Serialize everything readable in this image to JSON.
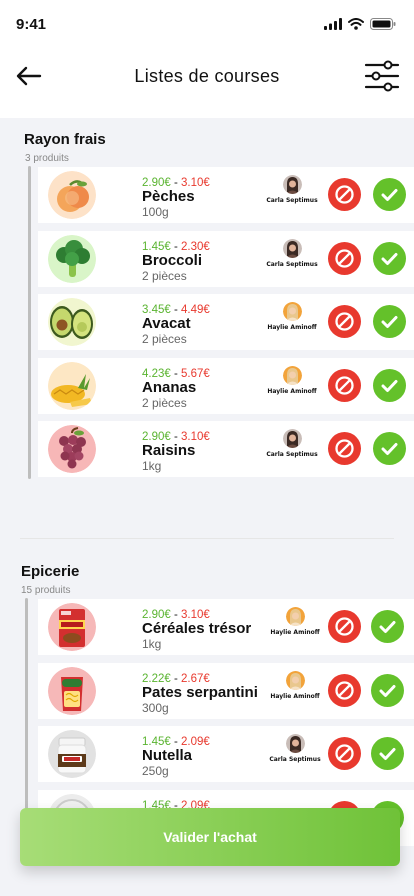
{
  "status_bar": {
    "time": "9:41"
  },
  "header": {
    "title": "Listes de courses"
  },
  "sections": [
    {
      "title": "Rayon frais",
      "count": "3 produits",
      "items": [
        {
          "price_low": "2.90€",
          "price_high": "3.10€",
          "name": "Pèches",
          "qty": "100g",
          "user": "Carla Septimus",
          "thumb_bg": "#fde2c8",
          "product": "peach"
        },
        {
          "price_low": "1.45€",
          "price_high": "2.30€",
          "name": "Broccoli",
          "qty": "2 pièces",
          "user": "Carla Septimus",
          "thumb_bg": "#d9f5c8",
          "product": "broccoli"
        },
        {
          "price_low": "3.45€",
          "price_high": "4.49€",
          "name": "Avacat",
          "qty": "2 pièces",
          "user": "Haylie Aminoff",
          "thumb_bg": "#f1f6cf",
          "product": "avocado"
        },
        {
          "price_low": "4.23€",
          "price_high": "5.67€",
          "name": "Ananas",
          "qty": "2 pièces",
          "user": "Haylie Aminoff",
          "thumb_bg": "#fde7c4",
          "product": "pineapple"
        },
        {
          "price_low": "2.90€",
          "price_high": "3.10€",
          "name": "Raisins",
          "qty": "1kg",
          "user": "Carla Septimus",
          "thumb_bg": "#f7b7b7",
          "product": "grapes"
        }
      ]
    },
    {
      "title": "Epicerie",
      "count": "15 produits",
      "items": [
        {
          "price_low": "2.90€",
          "price_high": "3.10€",
          "name": "Céréales trésor",
          "qty": "1kg",
          "user": "Haylie Aminoff",
          "thumb_bg": "#f6b8b8",
          "product": "cereal"
        },
        {
          "price_low": "2.22€",
          "price_high": "2.67€",
          "name": "Pates serpantini",
          "qty": "300g",
          "user": "Haylie Aminoff",
          "thumb_bg": "#f6b8b8",
          "product": "pasta"
        },
        {
          "price_low": "1.45€",
          "price_high": "2.09€",
          "name": "Nutella",
          "qty": "250g",
          "user": "Carla Septimus",
          "thumb_bg": "#e2e2e2",
          "product": "nutella"
        },
        {
          "price_low": "1.45€",
          "price_high": "2.09€",
          "name": "",
          "qty": "",
          "user": "",
          "thumb_bg": "#ececec",
          "product": "partial"
        }
      ]
    }
  ],
  "validate_button": {
    "label": "Valider l'achat"
  },
  "colors": {
    "price_low": "#5ab430",
    "price_high": "#e8392e",
    "remove": "#e8392e",
    "check": "#64c12a",
    "accent_gradient_start": "#a7dd77",
    "accent_gradient_end": "#6fc238"
  }
}
